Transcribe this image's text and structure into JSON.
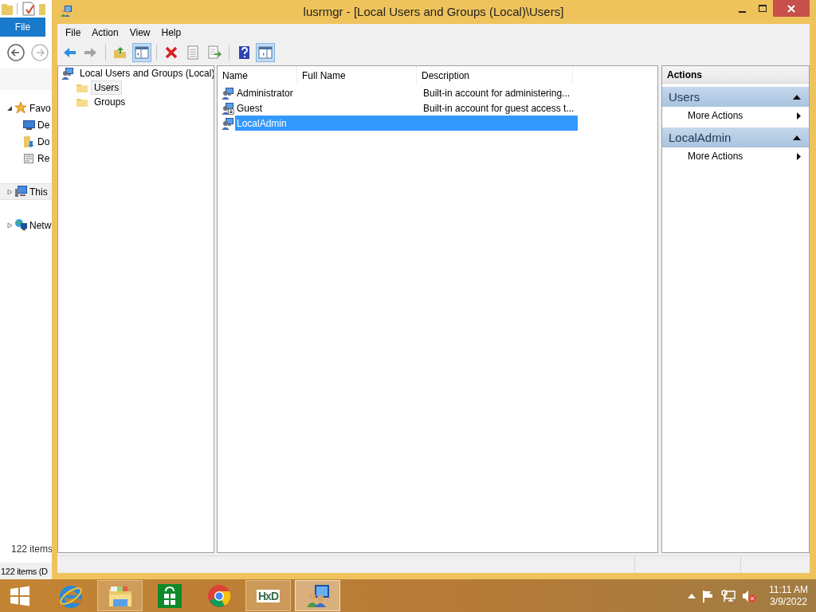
{
  "background_window": {
    "ribbon_tab": "File",
    "tree": [
      {
        "kind": "favorites",
        "label": "Favo",
        "expanded": true,
        "selected": false,
        "children": [
          {
            "kind": "desktop",
            "label": "De",
            "selected": false
          },
          {
            "kind": "downloads",
            "label": "Do",
            "selected": false
          },
          {
            "kind": "recent",
            "label": "Re",
            "selected": false
          }
        ]
      },
      {
        "kind": "computer",
        "label": "This",
        "expanded": false,
        "selected": true
      },
      {
        "kind": "network",
        "label": "Netw",
        "expanded": false,
        "selected": false
      }
    ],
    "item_count": "122 items",
    "status": "122 items (D"
  },
  "window": {
    "title": "lusrmgr - [Local Users and Groups (Local)\\Users]"
  },
  "menu": [
    "File",
    "Action",
    "View",
    "Help"
  ],
  "toolbar": [
    {
      "kind": "back",
      "pressed": false,
      "disabled": false
    },
    {
      "kind": "forward",
      "pressed": false,
      "disabled": true
    },
    {
      "kind": "separator"
    },
    {
      "kind": "up",
      "pressed": false,
      "disabled": false
    },
    {
      "kind": "tree_toggle",
      "pressed": true,
      "disabled": false
    },
    {
      "kind": "separator"
    },
    {
      "kind": "delete",
      "pressed": false,
      "disabled": false
    },
    {
      "kind": "properties",
      "pressed": false,
      "disabled": false
    },
    {
      "kind": "export",
      "pressed": false,
      "disabled": false
    },
    {
      "kind": "separator"
    },
    {
      "kind": "help",
      "pressed": false,
      "disabled": false
    },
    {
      "kind": "action_pane",
      "pressed": true,
      "disabled": false
    }
  ],
  "scope_tree": {
    "label": "Local Users and Groups (Local)",
    "selected": false,
    "children": [
      {
        "label": "Users",
        "selected": true
      },
      {
        "label": "Groups",
        "selected": false
      }
    ]
  },
  "table": {
    "columns": [
      "Name",
      "Full Name",
      "Description"
    ],
    "rows": [
      {
        "kind": "user",
        "name": "Administrator",
        "description": "Built-in account for administering...",
        "selected": false
      },
      {
        "kind": "guest",
        "name": "Guest",
        "description": "Built-in account for guest access t...",
        "selected": false
      },
      {
        "kind": "user",
        "name": "LocalAdmin",
        "selected": true
      }
    ]
  },
  "actions": {
    "title": "Actions",
    "sections": [
      {
        "heading": "Users",
        "expanded": true,
        "items": [
          {
            "label": "More Actions",
            "submenu": true
          }
        ]
      },
      {
        "heading": "LocalAdmin",
        "expanded": true,
        "items": [
          {
            "label": "More Actions",
            "submenu": true
          }
        ]
      }
    ]
  },
  "taskbar": {
    "apps": [
      {
        "kind": "start",
        "running": false,
        "active": false
      },
      {
        "kind": "ie",
        "running": false,
        "active": false
      },
      {
        "kind": "explorer",
        "running": true,
        "active": false
      },
      {
        "kind": "store",
        "running": false,
        "active": false
      },
      {
        "kind": "chrome",
        "running": false,
        "active": false
      },
      {
        "kind": "hxd",
        "logo": "HxD",
        "running": true,
        "active": false
      },
      {
        "kind": "lusrmgr",
        "running": true,
        "active": true
      }
    ],
    "tray": [
      {
        "kind": "show_hidden"
      },
      {
        "kind": "flag"
      },
      {
        "kind": "network"
      },
      {
        "kind": "volume_muted"
      }
    ],
    "time": "11:11 AM",
    "date": "3/9/2022"
  }
}
